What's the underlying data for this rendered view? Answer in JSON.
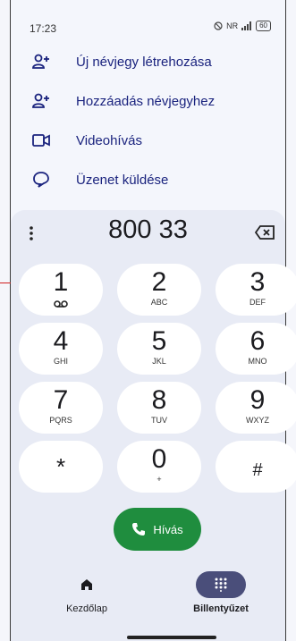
{
  "status": {
    "time": "17:23",
    "network_label": "NR",
    "battery": "60"
  },
  "actions": [
    {
      "label": "Új névjegy létrehozása",
      "icon": "add-person-icon"
    },
    {
      "label": "Hozzáadás névjegyhez",
      "icon": "add-person-icon"
    },
    {
      "label": "Videohívás",
      "icon": "video-call-icon"
    },
    {
      "label": "Üzenet küldése",
      "icon": "message-icon"
    }
  ],
  "dialer": {
    "number": "800 33"
  },
  "keys": [
    {
      "digit": "1",
      "letters": ""
    },
    {
      "digit": "2",
      "letters": "ABC"
    },
    {
      "digit": "3",
      "letters": "DEF"
    },
    {
      "digit": "4",
      "letters": "GHI"
    },
    {
      "digit": "5",
      "letters": "JKL"
    },
    {
      "digit": "6",
      "letters": "MNO"
    },
    {
      "digit": "7",
      "letters": "PQRS"
    },
    {
      "digit": "8",
      "letters": "TUV"
    },
    {
      "digit": "9",
      "letters": "WXYZ"
    },
    {
      "digit": "*",
      "letters": ""
    },
    {
      "digit": "0",
      "letters": "+"
    },
    {
      "digit": "#",
      "letters": ""
    }
  ],
  "call": {
    "label": "Hívás"
  },
  "nav": {
    "home_label": "Kezdőlap",
    "keypad_label": "Billentyűzet"
  },
  "colors": {
    "accent": "#1a237e",
    "call_green": "#1f8d3e",
    "nav_active": "#4a4e7a"
  }
}
